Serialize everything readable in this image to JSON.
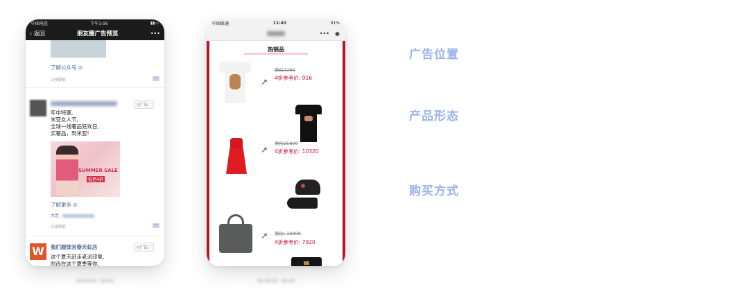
{
  "phone1": {
    "status": {
      "carrier": "中国电信",
      "time": "下午3:06"
    },
    "nav": {
      "back": "返回",
      "title": "朋友圈广告预览",
      "more": "•••"
    },
    "post_prev": {
      "link": "了解公众号",
      "time": "1分钟前"
    },
    "post_main": {
      "ad_badge": "广告",
      "lines": [
        "年中特惠,",
        "米亚女人节,",
        "全球一线奢品狂欢日,",
        "买奢品，到米亚!"
      ],
      "banner_title": "SUMMER SALE",
      "banner_sub": "低至4折",
      "link": "了解更多",
      "location": "大连",
      "time": "1分钟前"
    },
    "post_next": {
      "avatar_letter": "W",
      "name": "我们服饰宜春天虹店",
      "ad_badge": "广告",
      "lines": [
        "这个夏天赶走老派印象,",
        "时尚在这个夏季等你,"
      ]
    }
  },
  "phone2": {
    "status": {
      "carrier": "中国联通",
      "time": "11:40",
      "battery": "91%"
    },
    "nav": {
      "more": "•••"
    },
    "section_title": "热销品",
    "products": [
      {
        "orig": "原价2290",
        "disc": "4折参考价: 916"
      },
      {
        "orig": "原价25800",
        "disc": "4折参考价: 10320"
      },
      {
        "orig": "原价: 19800",
        "disc": "4折参考价: 7920"
      }
    ]
  },
  "labels": [
    "广告位置",
    "产品形态",
    "购买方式"
  ],
  "colors": {
    "accent_label": "#9ab3e9",
    "frame_red": "#b3182a",
    "price_red": "#c8102e",
    "wechat_link": "#576b95"
  }
}
